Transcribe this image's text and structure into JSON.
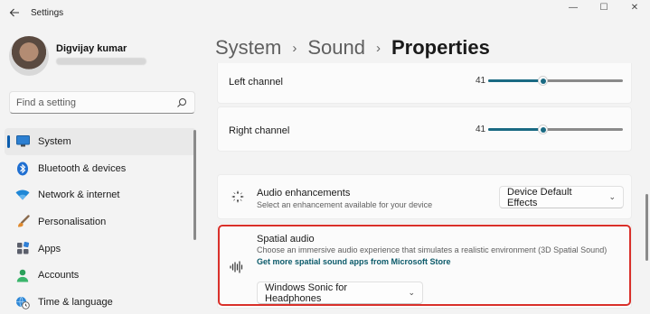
{
  "window": {
    "title": "Settings",
    "controls": {
      "minimize": "—",
      "maximize": "☐",
      "close": "✕"
    }
  },
  "user": {
    "name": "Digvijay kumar"
  },
  "search": {
    "placeholder": "Find a setting"
  },
  "sidebar": {
    "items": [
      {
        "label": "System",
        "icon": "monitor-icon",
        "active": true
      },
      {
        "label": "Bluetooth & devices",
        "icon": "bluetooth-icon"
      },
      {
        "label": "Network & internet",
        "icon": "wifi-icon"
      },
      {
        "label": "Personalisation",
        "icon": "brush-icon"
      },
      {
        "label": "Apps",
        "icon": "apps-icon"
      },
      {
        "label": "Accounts",
        "icon": "person-icon"
      },
      {
        "label": "Time & language",
        "icon": "globe-clock-icon"
      }
    ]
  },
  "breadcrumb": {
    "level1": "System",
    "level2": "Sound",
    "current": "Properties",
    "separator": "›"
  },
  "left_channel": {
    "label": "Left channel",
    "value": "41",
    "fraction": 0.41
  },
  "right_channel": {
    "label": "Right channel",
    "value": "41",
    "fraction": 0.41
  },
  "enhancements": {
    "title": "Audio enhancements",
    "subtitle": "Select an enhancement available for your device",
    "selected": "Device Default Effects",
    "icon": "enhancement-sparkle-icon"
  },
  "spatial": {
    "title": "Spatial audio",
    "subtitle": "Choose an immersive audio experience that simulates a realistic environment (3D Spatial Sound)",
    "link": "Get more spatial sound apps from Microsoft Store",
    "selected": "Windows Sonic for Headphones",
    "icon": "soundwave-icon"
  },
  "colors": {
    "accent": "#1a6a83",
    "highlight": "#d9302a",
    "link": "#0b5a6a"
  }
}
